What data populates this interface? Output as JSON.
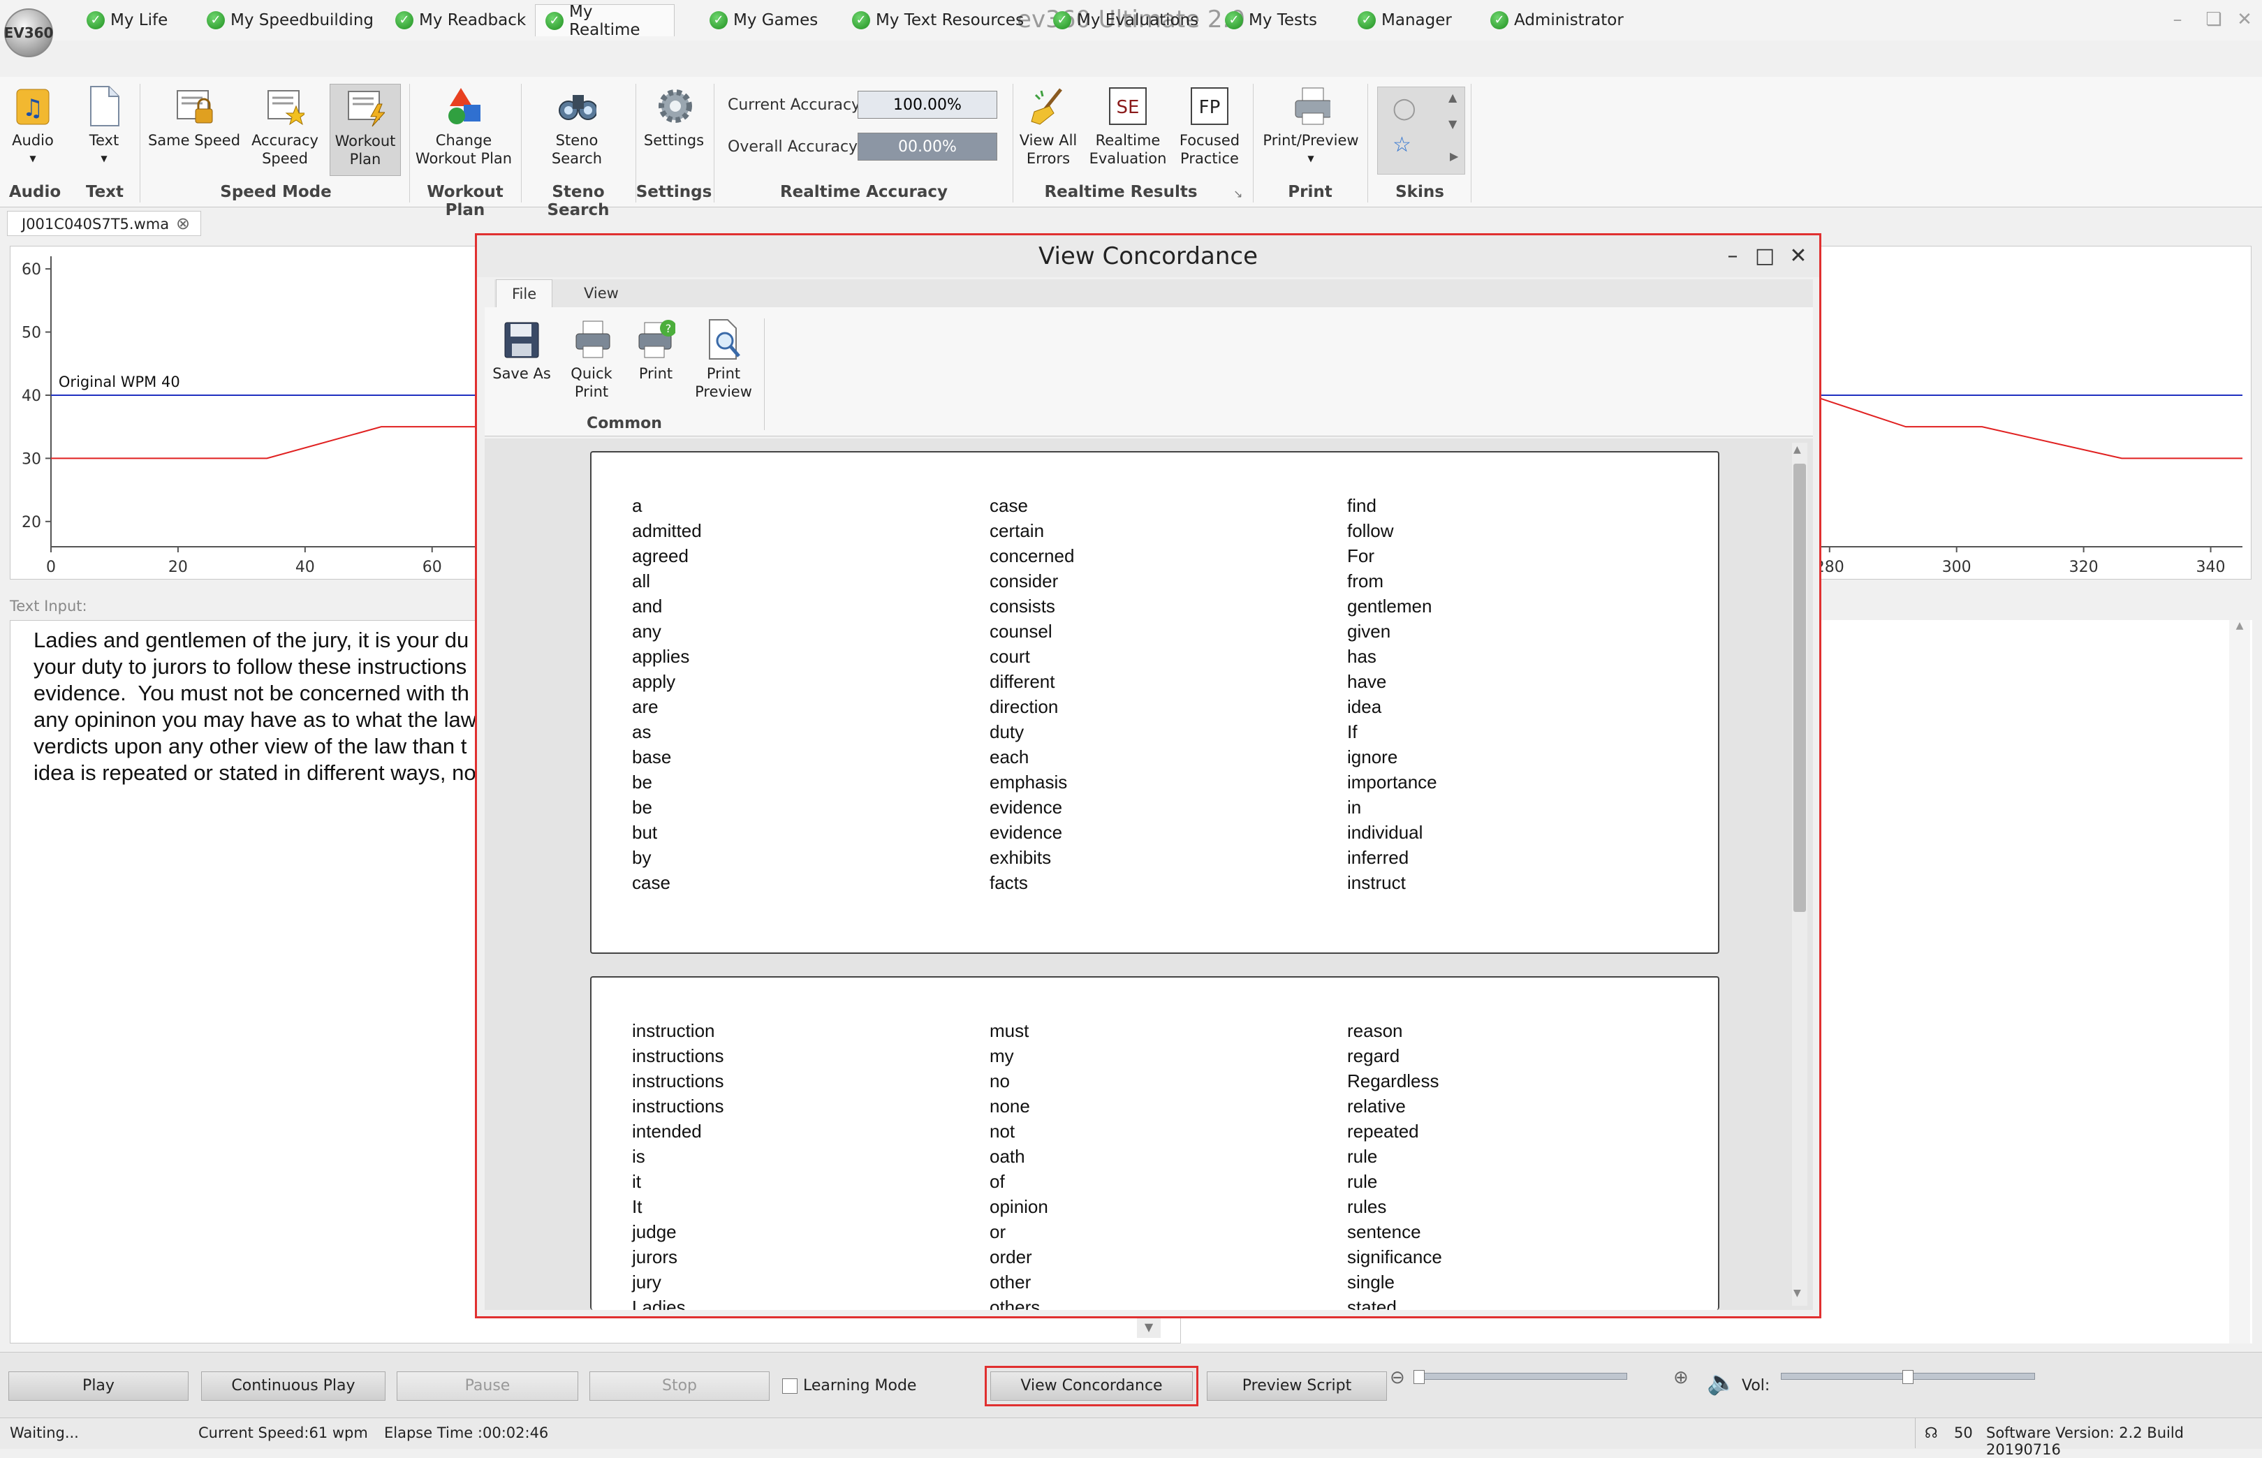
{
  "app": {
    "title": "ev360 Ultimate 2.0",
    "logo_text": "EV360"
  },
  "tabs": [
    {
      "label": "My Life"
    },
    {
      "label": "My Speedbuilding"
    },
    {
      "label": "My Readback"
    },
    {
      "label": "My Realtime"
    },
    {
      "label": "My Games"
    },
    {
      "label": "My Text Resources"
    },
    {
      "label": "My Evaluations"
    },
    {
      "label": "My Tests"
    },
    {
      "label": "Manager"
    },
    {
      "label": "Administrator"
    }
  ],
  "ribbon": {
    "audio": {
      "label": "Audio",
      "group": "Audio"
    },
    "text": {
      "label": "Text",
      "group": "Text"
    },
    "same_speed": "Same Speed",
    "accuracy_speed": [
      "Accuracy",
      "Speed"
    ],
    "workout_plan": [
      "Workout",
      "Plan"
    ],
    "speed_mode_group": "Speed Mode",
    "change_workout_plan": [
      "Change",
      "Workout Plan"
    ],
    "workout_plan_group": "Workout Plan",
    "steno_search": [
      "Steno",
      "Search"
    ],
    "steno_search_group": "Steno Search",
    "settings": "Settings",
    "settings_group": "Settings",
    "current_accuracy_label": "Current Accuracy",
    "current_accuracy_value": "100.00%",
    "overall_accuracy_label": "Overall Accuracy",
    "overall_accuracy_value": "00.00%",
    "realtime_accuracy_group": "Realtime Accuracy",
    "view_all_errors": [
      "View All",
      "Errors"
    ],
    "realtime_evaluation": [
      "Realtime",
      "Evaluation"
    ],
    "realtime_evaluation_icon_text": "SE",
    "focused_practice": [
      "Focused",
      "Practice"
    ],
    "focused_practice_icon_text": "FP",
    "realtime_results_group": "Realtime Results",
    "print_preview": "Print/Preview",
    "print_group": "Print",
    "skins_group": "Skins"
  },
  "document_tab": {
    "label": "J001C040S7T5.wma"
  },
  "chart_data": {
    "type": "line",
    "title": "",
    "xlabel": "",
    "ylabel": "",
    "xlim": [
      0,
      345
    ],
    "ylim": [
      16,
      62
    ],
    "x_ticks": [
      0,
      20,
      40,
      60,
      280,
      300,
      320,
      340
    ],
    "y_ticks": [
      60,
      50,
      40,
      30,
      20
    ],
    "series": [
      {
        "name": "Original WPM 40",
        "color": "#2030c0",
        "segments": [
          [
            [
              0,
              40
            ],
            [
              67,
              40
            ]
          ],
          [
            [
              277,
              40
            ],
            [
              345,
              40
            ]
          ]
        ]
      },
      {
        "color": "#e02020",
        "segments": [
          [
            [
              0,
              30
            ],
            [
              34,
              30
            ],
            [
              52,
              35
            ],
            [
              67,
              35
            ]
          ],
          [
            [
              277,
              40
            ],
            [
              292,
              35
            ],
            [
              304,
              35
            ],
            [
              326,
              30
            ],
            [
              345,
              30
            ]
          ]
        ]
      }
    ],
    "annotation": "Original WPM 40"
  },
  "text_input": {
    "label": "Text Input:",
    "lines": [
      "Ladies and gentlemen of the jury, it is your du",
      "your duty to jurors to follow these instructions",
      "evidence.  You must not be concerned with th",
      "any opininon you may have as to what the law",
      "verdicts upon any other view of the law than t",
      "idea is repeated or stated in different ways, no"
    ]
  },
  "dialog": {
    "title": "View Concordance",
    "tabs": [
      "File",
      "View"
    ],
    "buttons": {
      "save_as": [
        "Save As"
      ],
      "quick_print": [
        "Quick",
        "Print"
      ],
      "print": [
        "Print"
      ],
      "print_preview": [
        "Print",
        "Preview"
      ]
    },
    "group": "Common",
    "page1": {
      "col1": [
        "a",
        "admitted",
        "agreed",
        "all",
        "and",
        "any",
        "applies",
        "apply",
        "are",
        "as",
        "base",
        "be",
        "be",
        "but",
        "by",
        "case"
      ],
      "col2": [
        "case",
        "certain",
        "concerned",
        "consider",
        "consists",
        "counsel",
        "court",
        "different",
        "direction",
        "duty",
        "each",
        "emphasis",
        "evidence",
        "evidence",
        "exhibits",
        "facts"
      ],
      "col3": [
        "find",
        "follow",
        "For",
        "from",
        "gentlemen",
        "given",
        "has",
        "have",
        "idea",
        "If",
        "ignore",
        "importance",
        "in",
        "individual",
        "inferred",
        "instruct"
      ]
    },
    "page2": {
      "col1": [
        "instruction",
        "instructions",
        "instructions",
        "instructions",
        "intended",
        "is",
        "it",
        "It",
        "judge",
        "jurors",
        "jury",
        "Ladies"
      ],
      "col2": [
        "must",
        "my",
        "no",
        "none",
        "not",
        "oath",
        "of",
        "opinion",
        "or",
        "order",
        "other",
        "others"
      ],
      "col3": [
        "reason",
        "regard",
        "Regardless",
        "relative",
        "repeated",
        "rule",
        "rule",
        "rules",
        "sentence",
        "significance",
        "single",
        "stated"
      ]
    }
  },
  "controls": {
    "play": "Play",
    "continuous_play": "Continuous Play",
    "pause": "Pause",
    "stop": "Stop",
    "learning_mode": "Learning Mode",
    "view_concordance": "View Concordance",
    "preview_script": "Preview  Script",
    "vol_label": "Vol:"
  },
  "status": {
    "state": "Waiting...",
    "current_speed": "Current Speed:61 wpm",
    "elapse_time": "Elapse Time :00:02:46",
    "count": "50",
    "software_version": "Software Version:  2.2 Build 20190716"
  }
}
